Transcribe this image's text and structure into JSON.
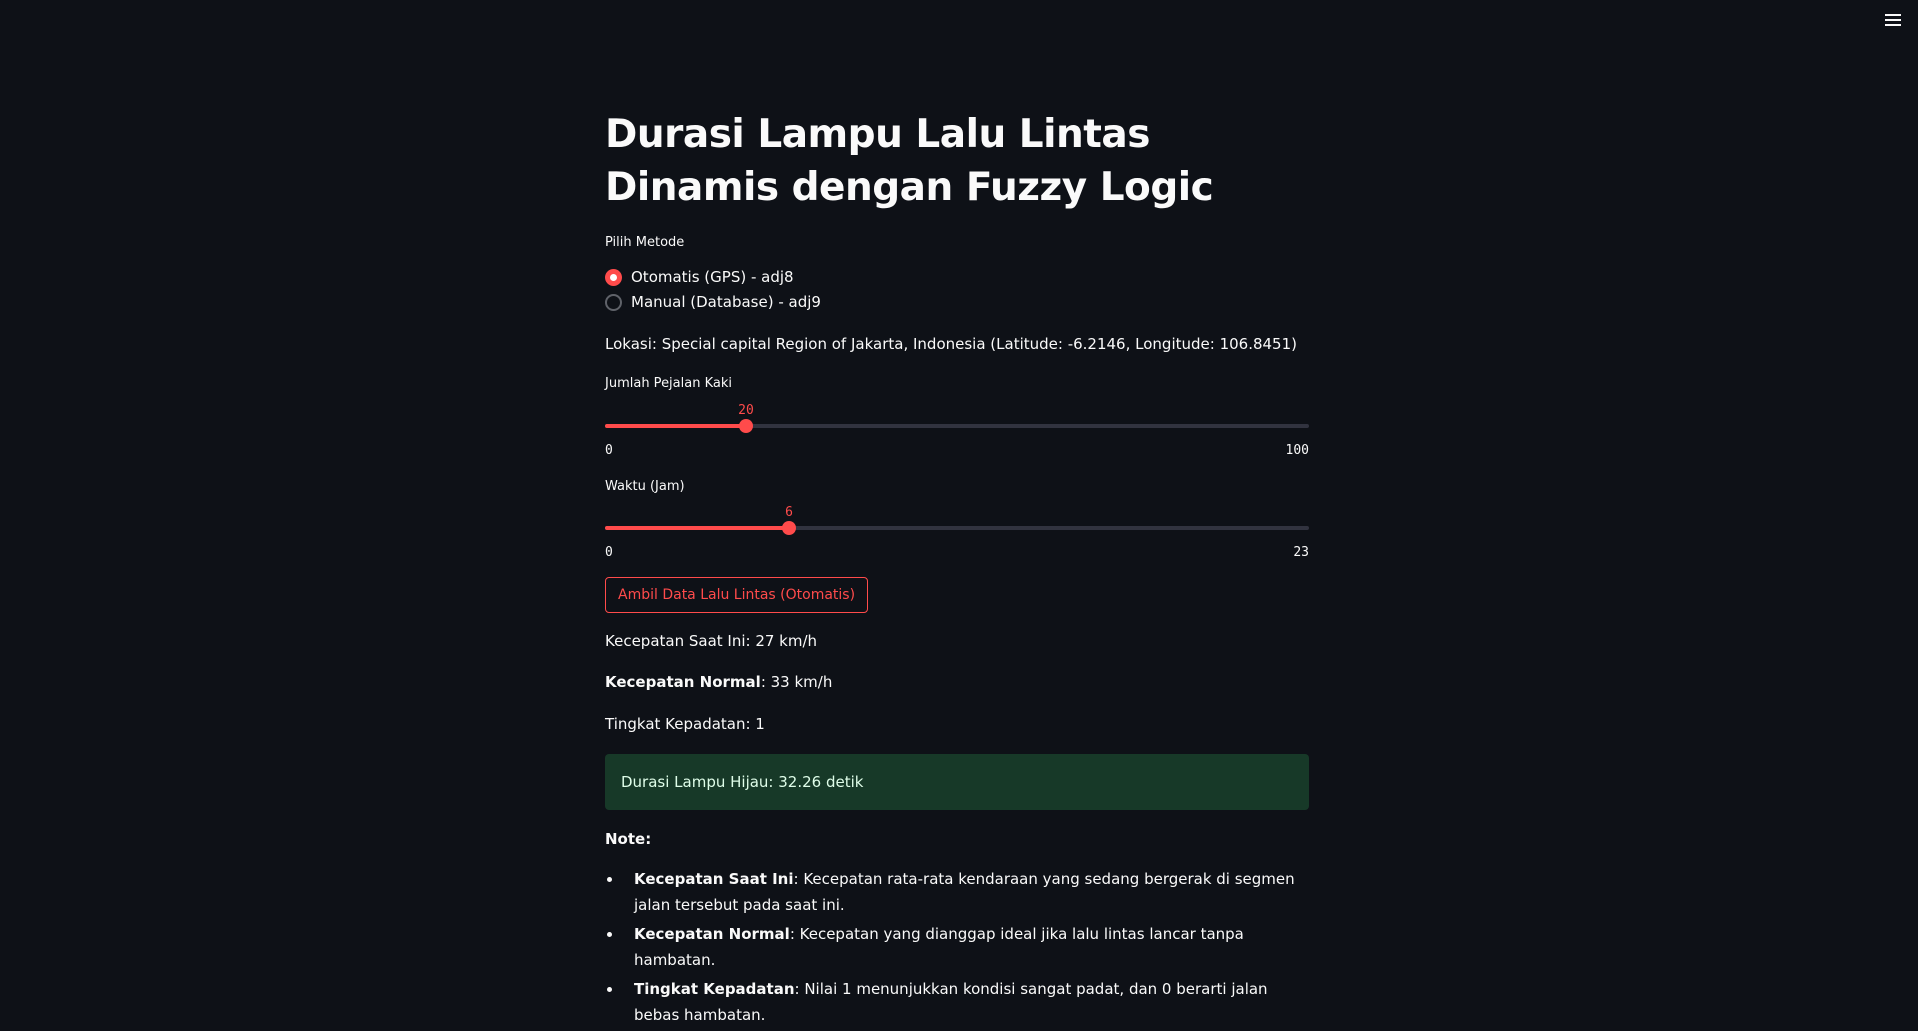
{
  "header": {
    "menu_icon": "hamburger-menu-icon"
  },
  "title": "Durasi Lampu Lalu Lintas Dinamis dengan Fuzzy Logic",
  "method": {
    "label": "Pilih Metode",
    "options": [
      {
        "label": "Otomatis (GPS) - adj8",
        "selected": true
      },
      {
        "label": "Manual (Database) - adj9",
        "selected": false
      }
    ]
  },
  "location_text": "Lokasi: Special capital Region of Jakarta, Indonesia (Latitude: -6.2146, Longitude: 106.8451)",
  "sliders": {
    "pedestrians": {
      "label": "Jumlah Pejalan Kaki",
      "value": "20",
      "min": "0",
      "max": "100",
      "fraction": 0.2
    },
    "hour": {
      "label": "Waktu (Jam)",
      "value": "6",
      "min": "0",
      "max": "23",
      "fraction": 0.2609
    }
  },
  "fetch_button": "Ambil Data Lalu Lintas (Otomatis)",
  "results": {
    "current_speed": "Kecepatan Saat Ini: 27 km/h",
    "normal_speed_label": "Kecepatan Normal",
    "normal_speed_value": ": 33 km/h",
    "density": "Tingkat Kepadatan: 1"
  },
  "success_message": "Durasi Lampu Hijau: 32.26 detik",
  "note": {
    "heading": "Note:",
    "items": [
      {
        "term": "Kecepatan Saat Ini",
        "desc": ": Kecepatan rata-rata kendaraan yang sedang bergerak di segmen jalan tersebut pada saat ini."
      },
      {
        "term": "Kecepatan Normal",
        "desc": ": Kecepatan yang dianggap ideal jika lalu lintas lancar tanpa hambatan."
      },
      {
        "term": "Tingkat Kepadatan",
        "desc": ": Nilai 1 menunjukkan kondisi sangat padat, dan 0 berarti jalan bebas hambatan."
      }
    ]
  },
  "colors": {
    "background": "#0e1117",
    "accent": "#ff4b4b",
    "success_bg": "#173928"
  }
}
